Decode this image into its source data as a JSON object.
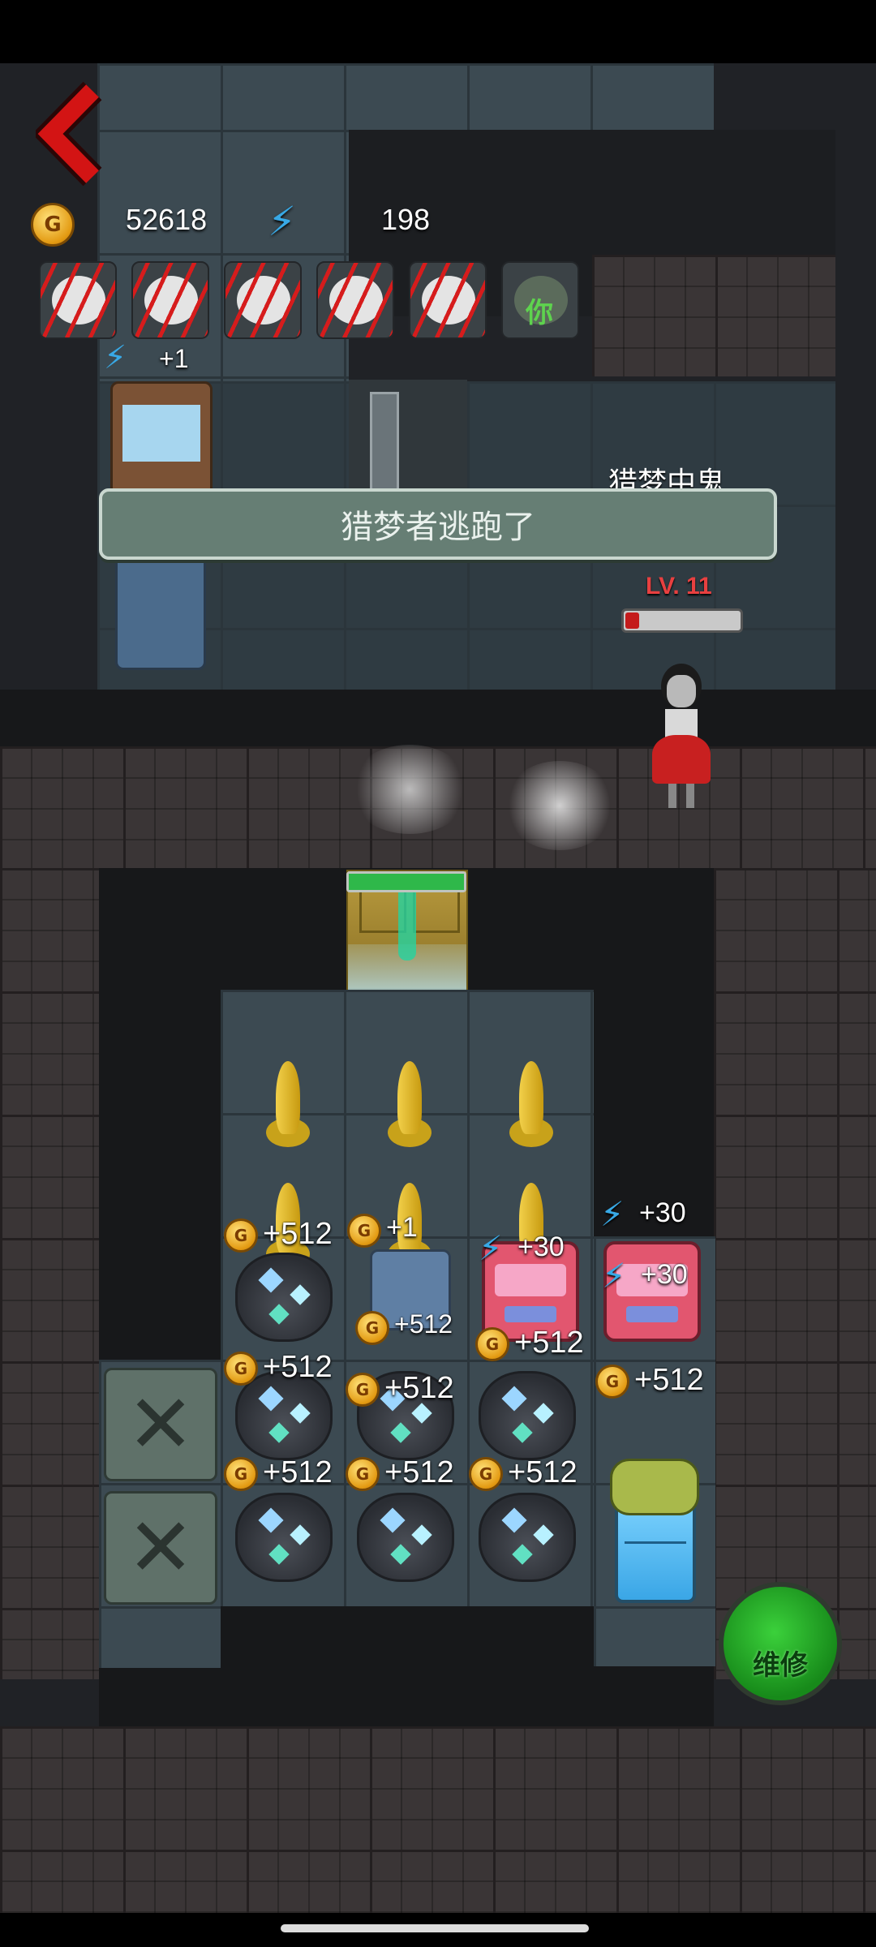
{
  "hud": {
    "coins": "52618",
    "energy": "198",
    "coin_symbol": "G"
  },
  "hunters": {
    "count": 6,
    "last_label": "你",
    "energy_gain": "+1"
  },
  "toast": {
    "message": "猎梦者逃跑了"
  },
  "status_text": "猎梦中鬼",
  "hunter": {
    "level": "LV. 11",
    "hp_fraction": 0.12
  },
  "door": {
    "hp_fraction": 1.0
  },
  "gains": {
    "turret_energy": "+30",
    "energy_right": "+30",
    "coin_512": "+512",
    "coin_1": "+1",
    "energy_30": "+30"
  },
  "repair_button": {
    "label": "维修"
  },
  "colors": {
    "accent_red": "#d31414",
    "toast_bg": "#667e74",
    "repair_green": "#1ea41f",
    "hp_red": "#c41b1b"
  }
}
